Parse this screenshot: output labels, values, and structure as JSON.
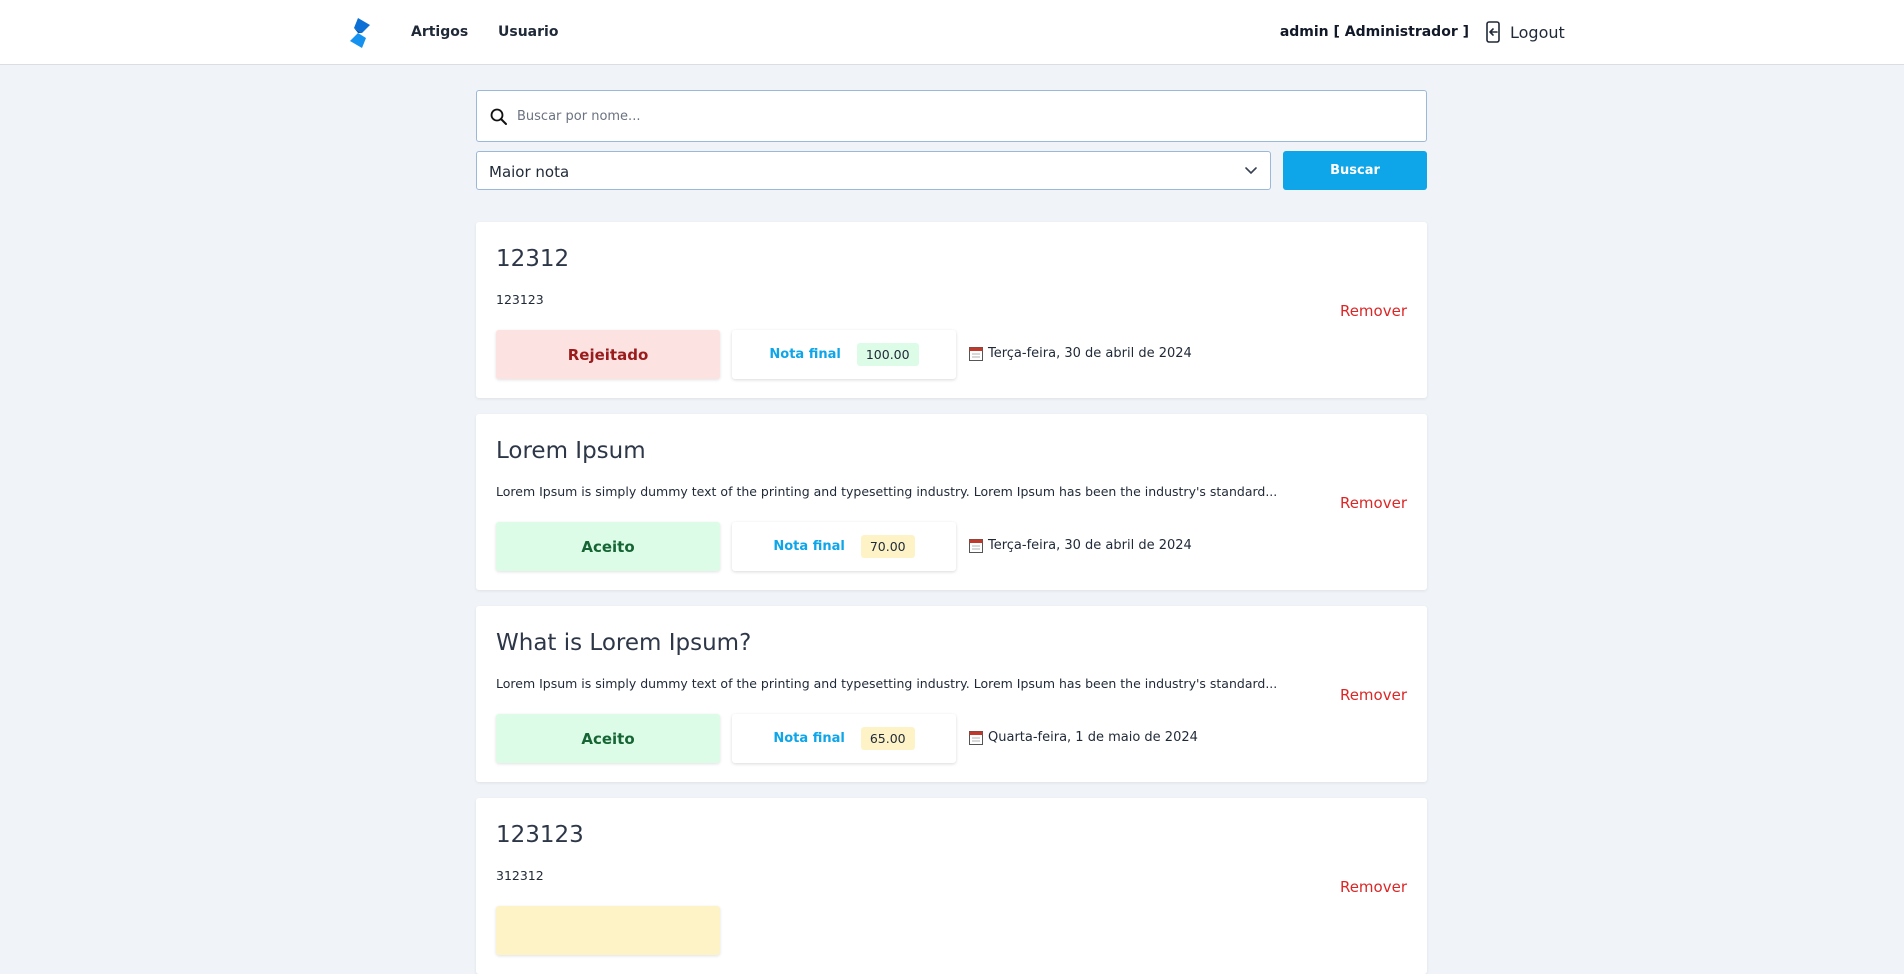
{
  "header": {
    "nav": [
      {
        "label": "Artigos"
      },
      {
        "label": "Usuario"
      }
    ],
    "user": "admin [ Administrador ]",
    "logout_label": "Logout",
    "logo_icon": "brand-logo-icon"
  },
  "search": {
    "placeholder": "Buscar por nome...",
    "value": ""
  },
  "sort": {
    "selected": "Maior nota"
  },
  "buscar_label": "Buscar",
  "articles": [
    {
      "title": "12312",
      "description": "123123",
      "status": "Rejeitado",
      "nota_label": "Nota final",
      "nota": "100.00",
      "date": "Terça-feira, 30 de abril de 2024",
      "remove_label": "Remover"
    },
    {
      "title": "Lorem Ipsum",
      "description": "Lorem Ipsum is simply dummy text of the printing and typesetting industry. Lorem Ipsum has been the industry's standard...",
      "status": "Aceito",
      "nota_label": "Nota final",
      "nota": "70.00",
      "date": "Terça-feira, 30 de abril de 2024",
      "remove_label": "Remover"
    },
    {
      "title": "What is Lorem Ipsum?",
      "description": "Lorem Ipsum is simply dummy text of the printing and typesetting industry. Lorem Ipsum has been the industry's standard...",
      "status": "Aceito",
      "nota_label": "Nota final",
      "nota": "65.00",
      "date": "Quarta-feira, 1 de maio de 2024",
      "remove_label": "Remover"
    },
    {
      "title": "123123",
      "description": "312312",
      "status": "",
      "nota_label": "",
      "nota": "",
      "date": "",
      "remove_label": "Remover"
    }
  ],
  "colors": {
    "accent": "#0ea5e9",
    "danger": "#dc2626",
    "rejected_bg": "#fde2e2",
    "accepted_bg": "#dcfce7",
    "pending_bg": "#fef3c7"
  }
}
